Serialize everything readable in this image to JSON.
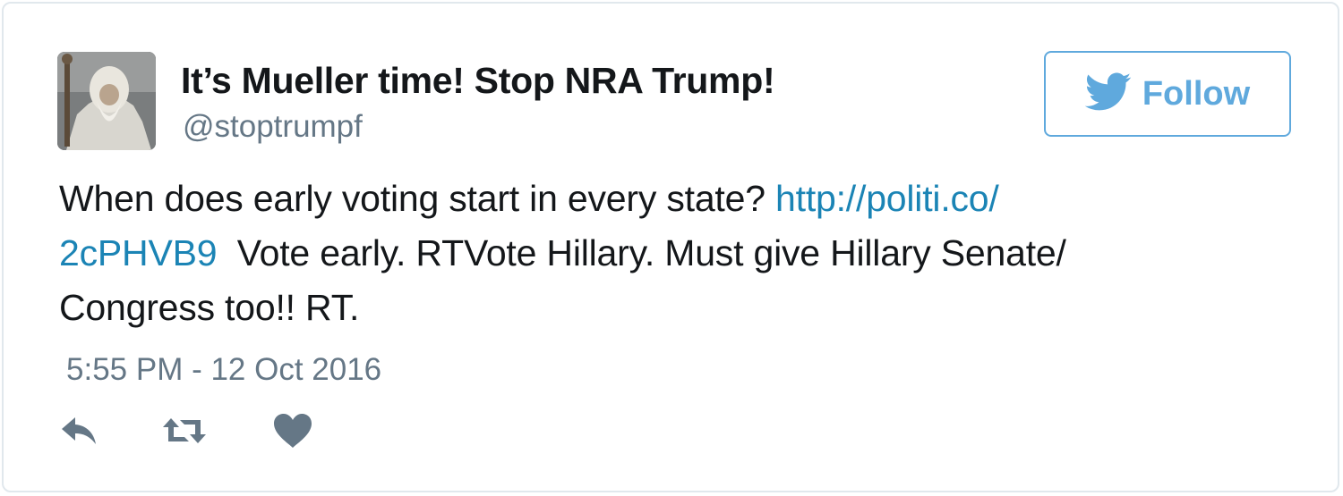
{
  "user": {
    "display_name": "It’s Mueller time! Stop NRA Trump!",
    "handle": "@stoptrumpf"
  },
  "follow_button": {
    "label": "Follow",
    "icon": "twitter-bird-icon",
    "color": "#5fa9dd"
  },
  "tweet": {
    "text_part1": "When does early voting start in every state?",
    "link_part1": "http://politi.co/",
    "link_part2": "2cPHVB9",
    "text_part2": "Vote early. RTVote Hillary. Must give Hillary Senate/",
    "text_part3": "Congress too!! RT.",
    "link_color": "#1b84b5"
  },
  "timestamp": "5:55 PM - 12 Oct 2016",
  "actions": [
    {
      "name": "reply",
      "icon": "reply-icon"
    },
    {
      "name": "retweet",
      "icon": "retweet-icon"
    },
    {
      "name": "like",
      "icon": "heart-icon"
    }
  ]
}
